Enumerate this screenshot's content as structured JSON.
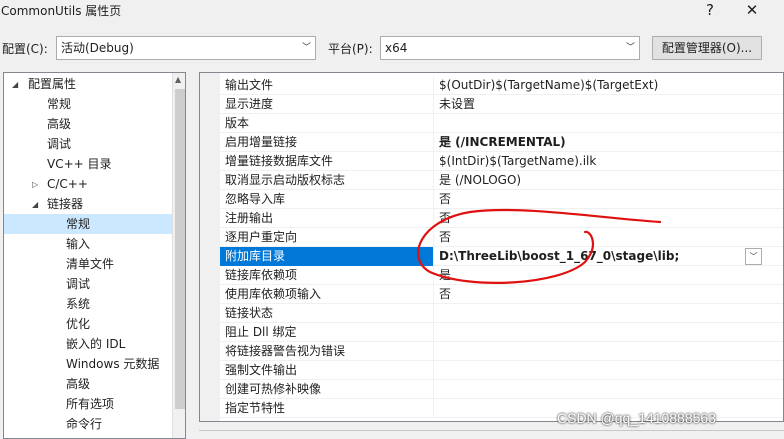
{
  "window": {
    "title": "CommonUtils 属性页",
    "help_glyph": "?",
    "close_glyph": "✕"
  },
  "toolbar": {
    "config_label": "配置(C):",
    "config_value": "活动(Debug)",
    "platform_label": "平台(P):",
    "platform_value": "x64",
    "config_manager_button": "配置管理器(O)..."
  },
  "tree": {
    "items": [
      {
        "label": "配置属性",
        "level": 0,
        "expander": "◢",
        "selected": false
      },
      {
        "label": "常规",
        "level": 1,
        "expander": "",
        "selected": false
      },
      {
        "label": "高级",
        "level": 1,
        "expander": "",
        "selected": false
      },
      {
        "label": "调试",
        "level": 1,
        "expander": "",
        "selected": false
      },
      {
        "label": "VC++ 目录",
        "level": 1,
        "expander": "",
        "selected": false
      },
      {
        "label": "C/C++",
        "level": 1,
        "expander": "▷",
        "selected": false
      },
      {
        "label": "链接器",
        "level": 1,
        "expander": "◢",
        "selected": false
      },
      {
        "label": "常规",
        "level": 2,
        "expander": "",
        "selected": true
      },
      {
        "label": "输入",
        "level": 2,
        "expander": "",
        "selected": false
      },
      {
        "label": "清单文件",
        "level": 2,
        "expander": "",
        "selected": false
      },
      {
        "label": "调试",
        "level": 2,
        "expander": "",
        "selected": false
      },
      {
        "label": "系统",
        "level": 2,
        "expander": "",
        "selected": false
      },
      {
        "label": "优化",
        "level": 2,
        "expander": "",
        "selected": false
      },
      {
        "label": "嵌入的 IDL",
        "level": 2,
        "expander": "",
        "selected": false
      },
      {
        "label": "Windows 元数据",
        "level": 2,
        "expander": "",
        "selected": false
      },
      {
        "label": "高级",
        "level": 2,
        "expander": "",
        "selected": false
      },
      {
        "label": "所有选项",
        "level": 2,
        "expander": "",
        "selected": false
      },
      {
        "label": "命令行",
        "level": 2,
        "expander": "",
        "selected": false
      }
    ]
  },
  "grid": {
    "rows": [
      {
        "name": "输出文件",
        "value": "$(OutDir)$(TargetName)$(TargetExt)",
        "bold": false,
        "selected": false
      },
      {
        "name": "显示进度",
        "value": "未设置",
        "bold": false,
        "selected": false
      },
      {
        "name": "版本",
        "value": "",
        "bold": false,
        "selected": false
      },
      {
        "name": "启用增量链接",
        "value": "是 (/INCREMENTAL)",
        "bold": true,
        "selected": false
      },
      {
        "name": "增量链接数据库文件",
        "value": "$(IntDir)$(TargetName).ilk",
        "bold": false,
        "selected": false
      },
      {
        "name": "取消显示启动版权标志",
        "value": "是 (/NOLOGO)",
        "bold": false,
        "selected": false
      },
      {
        "name": "忽略导入库",
        "value": "否",
        "bold": false,
        "selected": false
      },
      {
        "name": "注册输出",
        "value": "否",
        "bold": false,
        "selected": false
      },
      {
        "name": "逐用户重定向",
        "value": "否",
        "bold": false,
        "selected": false
      },
      {
        "name": "附加库目录",
        "value": "D:\\ThreeLib\\boost_1_67_0\\stage\\lib;",
        "bold": true,
        "selected": true
      },
      {
        "name": "链接库依赖项",
        "value": "是",
        "bold": false,
        "selected": false
      },
      {
        "name": "使用库依赖项输入",
        "value": "否",
        "bold": false,
        "selected": false
      },
      {
        "name": "链接状态",
        "value": "",
        "bold": false,
        "selected": false
      },
      {
        "name": "阻止 Dll 绑定",
        "value": "",
        "bold": false,
        "selected": false
      },
      {
        "name": "将链接器警告视为错误",
        "value": "",
        "bold": false,
        "selected": false
      },
      {
        "name": "强制文件输出",
        "value": "",
        "bold": false,
        "selected": false
      },
      {
        "name": "创建可热修补映像",
        "value": "",
        "bold": false,
        "selected": false
      },
      {
        "name": "指定节特性",
        "value": "",
        "bold": false,
        "selected": false
      }
    ]
  },
  "watermark": "CSDN @qq_1410888563",
  "colors": {
    "selection_blue": "#0078d7",
    "tree_selection": "#cce8ff",
    "annotation_red": "#e01010"
  }
}
